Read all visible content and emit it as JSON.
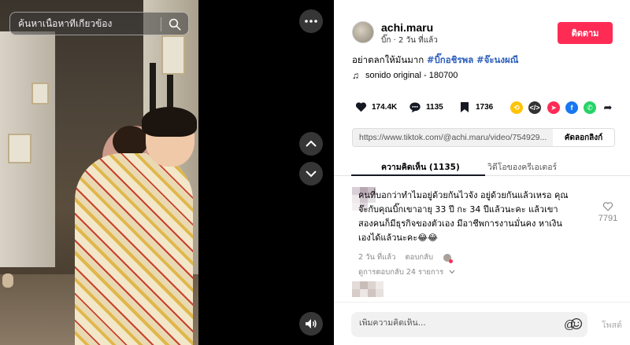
{
  "search": {
    "placeholder": "ค้นหาเนื้อหาที่เกี่ยวข้อง"
  },
  "video_controls": {
    "more_label": "•••",
    "up_label": "⌃",
    "down_label": "⌄"
  },
  "author": {
    "username": "achi.maru",
    "display_name": "บิ๊ก",
    "posted": "2 วัน ที่แล้ว",
    "meta_separator": " · ",
    "follow_label": "ติดตาม"
  },
  "caption": {
    "text": "อย่าตลกให้มันมาก ",
    "hashtags": [
      "#บิ๊กอชิรพล",
      "#จ๊ะนงผณี"
    ]
  },
  "music": {
    "title": "sonido original - 180700"
  },
  "stats": {
    "likes": "174.4K",
    "comments": "1135",
    "saves": "1736"
  },
  "share_icons": [
    {
      "name": "repost-icon",
      "color": "#ffc300"
    },
    {
      "name": "embed-icon",
      "color": "#333333"
    },
    {
      "name": "send-icon",
      "color": "#fe2c55"
    },
    {
      "name": "facebook-icon",
      "color": "#1877f2"
    },
    {
      "name": "whatsapp-icon",
      "color": "#25d366"
    },
    {
      "name": "share-arrow-icon",
      "color": "#161823"
    }
  ],
  "link": {
    "url": "https://www.tiktok.com/@achi.maru/video/754929...",
    "copy_label": "คัดลอกลิงก์"
  },
  "tabs": {
    "comments": "ความคิดเห็น (1135)",
    "creator_videos": "วิดีโอของครีเอเตอร์"
  },
  "comment": {
    "lines": [
      "คนที่บอกว่าทำไมอยู่ด้วยกันไวจัง อยู่ด้วยกันแล้วเหรอ คุณ",
      "จ๊ะกับคุณบิ๊กเขาอายุ 33 ปี กะ 34 ปีแล้วนะคะ แล้วเขา",
      "สองคนก็มีธุรกิจของตัวเอง มีอาชีพการงานมั่นคง หาเงิน",
      "เองได้แล้วนะคะ😂😂"
    ],
    "posted": "2 วัน ที่แล้ว",
    "reply_label": "ตอบกลับ",
    "view_replies": "ดูการตอบกลับ 24 รายการ",
    "like_count": "7791"
  },
  "bottom": {
    "comment_placeholder": "เพิ่มความคิดเห็น...",
    "at_symbol": "@",
    "post_label": "โพสต์"
  },
  "colors": {
    "accent": "#fe2c55",
    "hashtag": "#2b5db9"
  }
}
